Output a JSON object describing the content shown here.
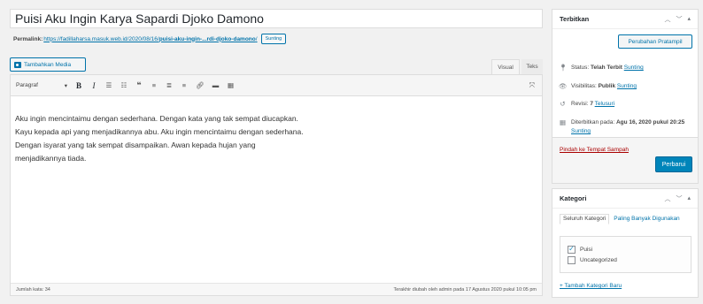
{
  "title": "Puisi Aku Ingin Karya Sapardi Djoko Damono",
  "permalink": {
    "label": "Permalink:",
    "url_prefix": "https://fadillaharsa.masuk.web.id/2020/08/16/",
    "slug": "puisi-aku-ingin-...rdi-djoko-damono",
    "suffix": "/",
    "edit_label": "Sunting"
  },
  "add_media_label": "Tambahkan Media",
  "tabs": {
    "visual": "Visual",
    "text": "Teks"
  },
  "toolbar": {
    "format": "Paragraf",
    "icons": [
      "bold-icon",
      "italic-icon",
      "bullet-list-icon",
      "numbered-list-icon",
      "blockquote-icon",
      "align-left-icon",
      "align-center-icon",
      "align-right-icon",
      "link-icon",
      "read-more-icon",
      "toolbar-toggle-icon",
      "fullscreen-icon"
    ]
  },
  "content": {
    "lines": [
      "Aku ingin mencintaimu dengan sederhana. Dengan kata yang tak sempat diucapkan.",
      "Kayu kepada api yang menjadikannya abu. Aku ingin mencintaimu dengan sederhana.",
      "Dengan isyarat yang tak sempat disampaikan. Awan kepada hujan yang",
      "menjadikannya tiada."
    ]
  },
  "status_bar": {
    "word_count": "Jumlah kata: 34",
    "last_edited": "Terakhir diubah oleh admin pada 17 Agustus 2020 pukul 10:05 pm"
  },
  "publish": {
    "title": "Terbitkan",
    "preview_label": "Perubahan Pratampil",
    "status_label": "Status:",
    "status_value": "Telah Terbit",
    "status_edit": "Sunting",
    "visibility_label": "Visibilitas:",
    "visibility_value": "Publik",
    "visibility_edit": "Sunting",
    "revisions_label": "Revisi:",
    "revisions_value": "7",
    "revisions_link": "Telusuri",
    "date_label": "Diterbitkan pada:",
    "date_value": "Agu 16, 2020 pukul 20:25",
    "date_edit": "Sunting",
    "trash_label": "Pindah ke Tempat Sampah",
    "update_label": "Perbarui"
  },
  "categories": {
    "title": "Kategori",
    "tab_all": "Seluruh Kategori",
    "tab_popular": "Paling Banyak Digunakan",
    "items": [
      {
        "label": "Puisi",
        "checked": true
      },
      {
        "label": "Uncategorized",
        "checked": false
      }
    ],
    "add_new": "+ Tambah Kategori Baru"
  },
  "colors": {
    "accent": "#0073aa",
    "primary_button": "#0085ba",
    "trash": "#a00000"
  }
}
